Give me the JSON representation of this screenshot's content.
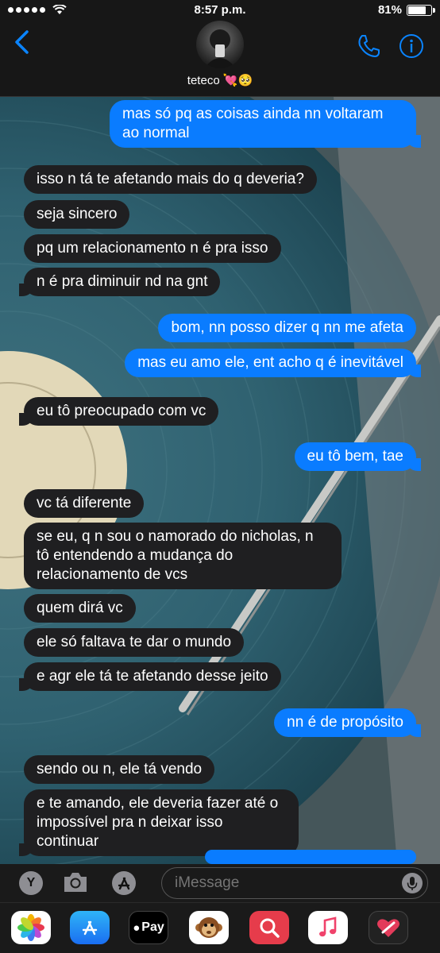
{
  "status": {
    "time": "8:57 p.m.",
    "battery": "81%",
    "battery_level": 0.81,
    "signal_bars": 5
  },
  "header": {
    "contact_name": "teteco 💘🥺",
    "back_icon": "chevron-left-icon",
    "phone_icon": "phone-icon",
    "info_icon": "info-icon"
  },
  "messages": [
    {
      "dir": "out",
      "text": "mas só pq as coisas ainda nn voltaram ao normal"
    },
    {
      "dir": "in",
      "text": "isso n tá te afetando mais do q deveria?"
    },
    {
      "dir": "in",
      "text": "seja sincero"
    },
    {
      "dir": "in",
      "text": "pq um relacionamento n é pra isso"
    },
    {
      "dir": "in",
      "text": "n é pra diminuir nd na gnt"
    },
    {
      "dir": "out",
      "text": "bom, nn posso dizer q nn me afeta"
    },
    {
      "dir": "out",
      "text": "mas eu amo ele, ent acho q é inevitável"
    },
    {
      "dir": "in",
      "text": "eu tô preocupado com vc"
    },
    {
      "dir": "out",
      "text": "eu tô bem, tae"
    },
    {
      "dir": "in",
      "text": "vc tá diferente"
    },
    {
      "dir": "in",
      "text": "se eu, q n sou o namorado do nicholas, n tô entendendo a mudança do relacionamento de vcs"
    },
    {
      "dir": "in",
      "text": "quem dirá vc"
    },
    {
      "dir": "in",
      "text": "ele só faltava te dar o mundo"
    },
    {
      "dir": "in",
      "text": "e agr ele tá te afetando desse jeito"
    },
    {
      "dir": "out",
      "text": "nn é de propósito"
    },
    {
      "dir": "in",
      "text": "sendo ou n, ele tá vendo"
    },
    {
      "dir": "in",
      "text": "e te amando, ele deveria fazer até o impossível pra n deixar isso continuar"
    }
  ],
  "input": {
    "placeholder": "iMessage",
    "apps_button": "Y",
    "camera_icon": "camera-icon",
    "appstore_icon": "app-store-icon",
    "mic_icon": "microphone-icon"
  },
  "app_drawer": [
    {
      "name": "photos-icon"
    },
    {
      "name": "app-store-icon"
    },
    {
      "name": "apple-pay-icon",
      "label": "Pay"
    },
    {
      "name": "animoji-icon"
    },
    {
      "name": "search-images-icon"
    },
    {
      "name": "music-icon"
    },
    {
      "name": "digital-touch-icon"
    }
  ],
  "colors": {
    "outgoing": "#0a7cff",
    "incoming": "#1f1f21",
    "accent": "#0a84ff"
  }
}
